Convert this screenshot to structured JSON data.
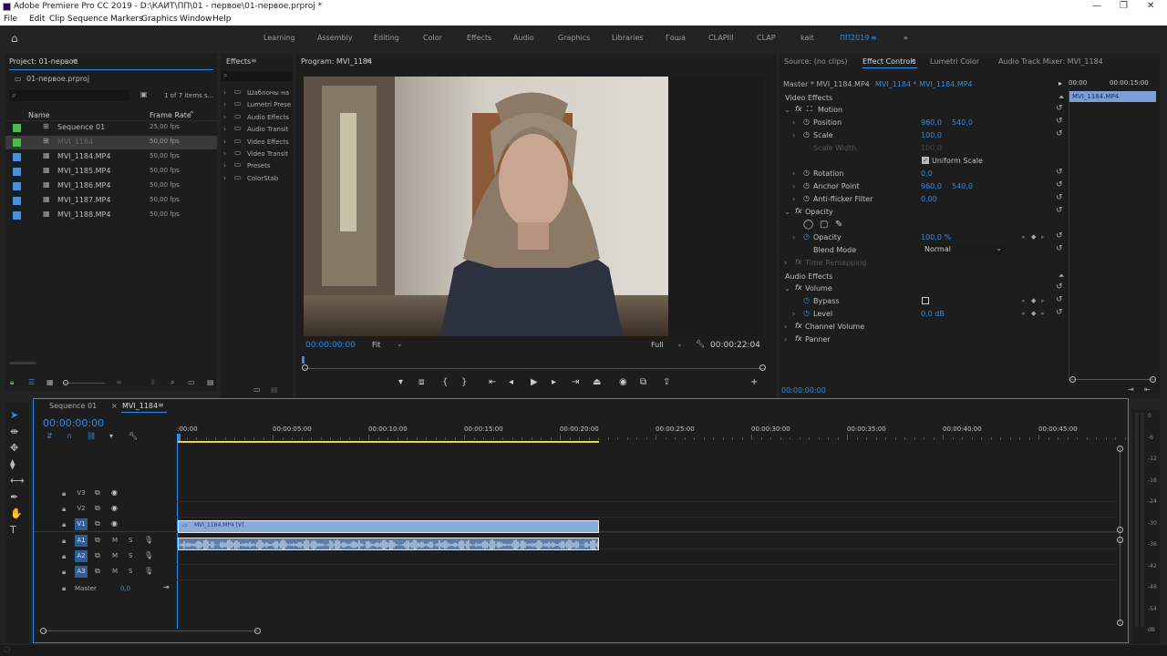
{
  "window": {
    "title": "Adobe Premiere Pro CC 2019 - D:\\КАИТ\\ПП\\01 - первое\\01-первое.prproj *",
    "controls": [
      "—",
      "❐",
      "✕"
    ]
  },
  "menu": [
    "File",
    "Edit",
    "Clip",
    "Sequence",
    "Markers",
    "Graphics",
    "Window",
    "Help"
  ],
  "workspaces": [
    {
      "label": "Learning"
    },
    {
      "label": "Assembly"
    },
    {
      "label": "Editing"
    },
    {
      "label": "Color"
    },
    {
      "label": "Effects"
    },
    {
      "label": "Audio"
    },
    {
      "label": "Graphics"
    },
    {
      "label": "Libraries"
    },
    {
      "label": "Гоша"
    },
    {
      "label": "CLAPIII"
    },
    {
      "label": "CLAP"
    },
    {
      "label": "kait"
    },
    {
      "label": "ПП2019",
      "active": true
    }
  ],
  "workspace_more": "»",
  "project": {
    "title": "Project: 01-первое",
    "file": "01-первое.prproj",
    "items_count": "1 of 7 items s...",
    "col_name": "Name",
    "col_rate": "Frame Rate",
    "items": [
      {
        "name": "Sequence 01",
        "rate": "25,00 fps",
        "color": "#4fb84f",
        "type": "seq"
      },
      {
        "name": "MVI_1184",
        "rate": "50,00 fps",
        "color": "#4fb84f",
        "type": "seq",
        "selected": true
      },
      {
        "name": "MVI_1184.MP4",
        "rate": "50,00 fps",
        "color": "#4a8fd6",
        "type": "clip"
      },
      {
        "name": "MVI_1185.MP4",
        "rate": "50,00 fps",
        "color": "#4a8fd6",
        "type": "clip"
      },
      {
        "name": "MVI_1186.MP4",
        "rate": "50,00 fps",
        "color": "#4a8fd6",
        "type": "clip"
      },
      {
        "name": "MVI_1187.MP4",
        "rate": "50,00 fps",
        "color": "#4a8fd6",
        "type": "clip"
      },
      {
        "name": "MVI_1188.MP4",
        "rate": "50,00 fps",
        "color": "#4a8fd6",
        "type": "clip"
      }
    ]
  },
  "effects": {
    "title": "Effects",
    "items": [
      "Шаблоны на",
      "Lumetri Prese",
      "Audio Effects",
      "Audio Transit",
      "Video Effects",
      "Video Transit",
      "Presets",
      "ColorStab"
    ]
  },
  "program": {
    "title": "Program: MVI_1184",
    "timecode": "00:00:00:00",
    "fit": "Fit",
    "quality": "Full",
    "duration": "00:00:22:04"
  },
  "effect_controls": {
    "tabs": [
      "Source: (no clips)",
      "Effect Controls",
      "Lumetri Color",
      "Audio Track Mixer: MVI_1184"
    ],
    "master": "Master * MVI_1184.MP4",
    "clip": "MVI_1184 * MVI_1184.MP4",
    "ruler": [
      "00:00",
      "00:00:15:00"
    ],
    "clip_bar": "MVI_1184.MP4",
    "video_effects": "Video Effects",
    "audio_effects": "Audio Effects",
    "timecode": "00:00:00:00",
    "rows": [
      {
        "label": "Motion",
        "kind": "fx"
      },
      {
        "label": "Position",
        "v1": "960,0",
        "v2": "540,0"
      },
      {
        "label": "Scale",
        "v1": "100,0"
      },
      {
        "label": "Scale Width",
        "v1": "100,0",
        "dim": true
      },
      {
        "label": "Uniform Scale",
        "check": true
      },
      {
        "label": "Rotation",
        "v1": "0,0"
      },
      {
        "label": "Anchor Point",
        "v1": "960,0",
        "v2": "540,0"
      },
      {
        "label": "Anti-flicker Filter",
        "v1": "0,00"
      },
      {
        "label": "Opacity",
        "kind": "fx"
      },
      {
        "label": "Opacity",
        "v1": "100,0 %"
      },
      {
        "label": "Blend Mode",
        "select": "Normal"
      },
      {
        "label": "Time Remapping",
        "kind": "fx"
      },
      {
        "label": "Volume",
        "kind": "fx"
      },
      {
        "label": "Bypass"
      },
      {
        "label": "Level",
        "v1": "0,0 dB"
      },
      {
        "label": "Channel Volume",
        "kind": "fx"
      },
      {
        "label": "Panner",
        "kind": "fx"
      }
    ]
  },
  "timeline": {
    "tabs": [
      "Sequence 01",
      "MVI_1184"
    ],
    "timecode": "00:00:00:00",
    "ruler": [
      ":00:00",
      "00:00:05:00",
      "00:00:10:00",
      "00:00:15:00",
      "00:00:20:00",
      "00:00:25:00",
      "00:00:30:00",
      "00:00:35:00",
      "00:00:40:00",
      "00:00:45:00"
    ],
    "video_tracks": [
      "V3",
      "V2",
      "V1"
    ],
    "audio_tracks": [
      "A1",
      "A2",
      "A3"
    ],
    "master_label": "Master",
    "master_value": "0,0",
    "video_clip": "MVI_1184.MP4 [V]",
    "meter": [
      "0",
      "-6",
      "-12",
      "-18",
      "-24",
      "-30",
      "-36",
      "-42",
      "-48",
      "-54",
      "dB"
    ]
  }
}
